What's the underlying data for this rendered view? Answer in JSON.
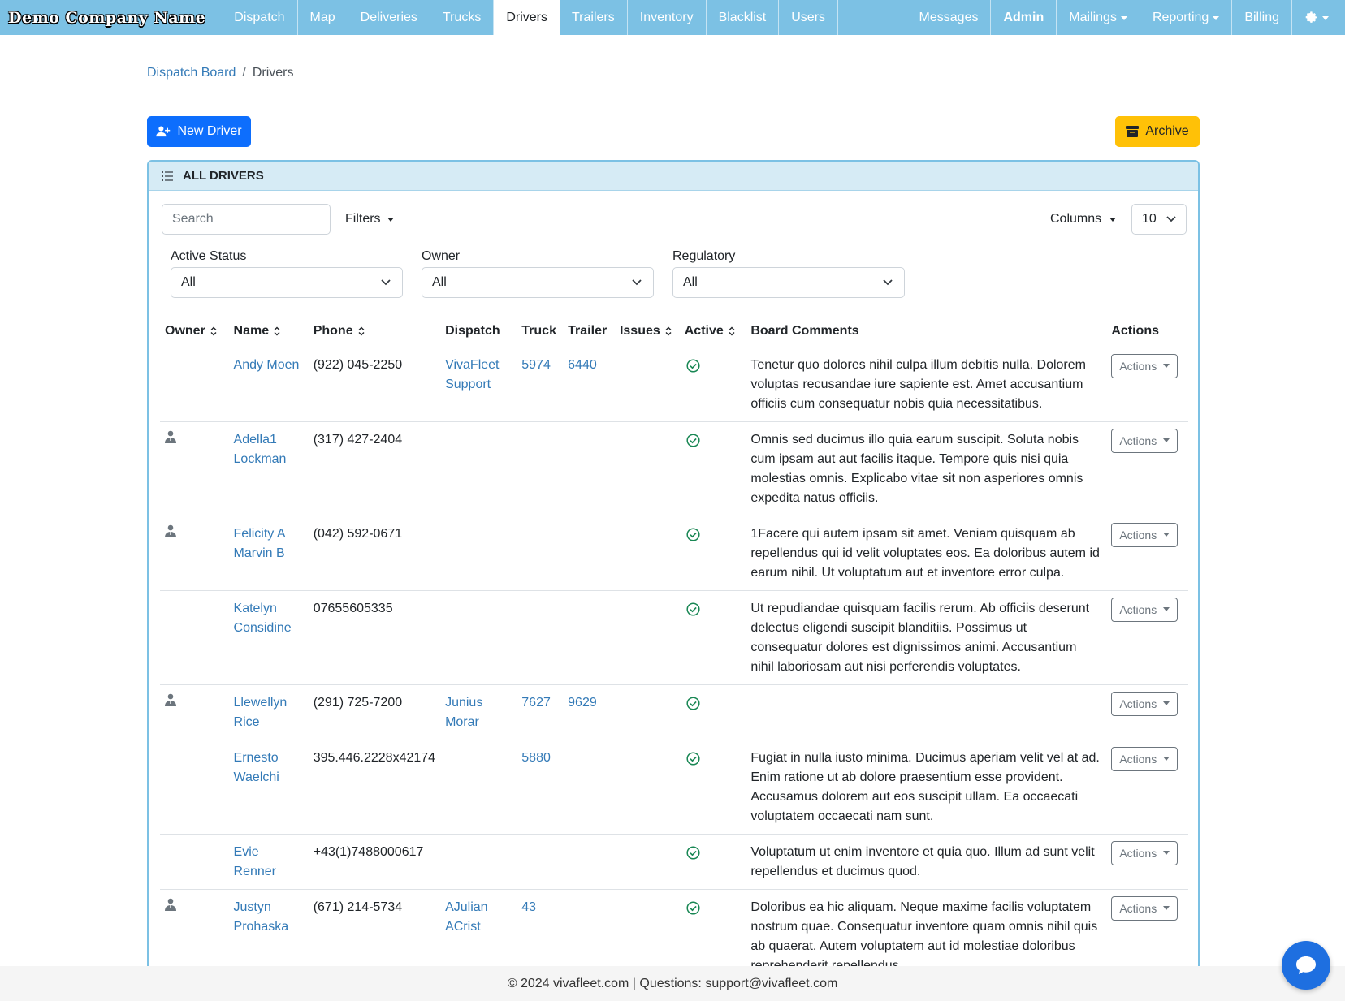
{
  "nav": {
    "brand": "Demo Company Name",
    "items": [
      {
        "label": "Dispatch",
        "name": "nav-dispatch"
      },
      {
        "label": "Map",
        "name": "nav-map"
      },
      {
        "label": "Deliveries",
        "name": "nav-deliveries"
      },
      {
        "label": "Trucks",
        "name": "nav-trucks"
      },
      {
        "label": "Drivers",
        "name": "nav-drivers"
      },
      {
        "label": "Trailers",
        "name": "nav-trailers"
      },
      {
        "label": "Inventory",
        "name": "nav-inventory"
      },
      {
        "label": "Blacklist",
        "name": "nav-blacklist"
      },
      {
        "label": "Users",
        "name": "nav-users"
      }
    ],
    "right": {
      "messages": "Messages",
      "admin": "Admin",
      "mailings": "Mailings",
      "reporting": "Reporting",
      "billing": "Billing"
    },
    "settings_icon": "gear-icon"
  },
  "breadcrumb": {
    "parent": "Dispatch Board",
    "separator": "/",
    "current": "Drivers"
  },
  "buttons": {
    "new_driver": "New Driver",
    "archive": "Archive"
  },
  "card": {
    "title": "ALL DRIVERS"
  },
  "toolbar": {
    "search_placeholder": "Search",
    "filters": "Filters",
    "columns": "Columns",
    "per_page": "10"
  },
  "filters": {
    "active_status": {
      "label": "Active Status",
      "value": "All"
    },
    "owner": {
      "label": "Owner",
      "value": "All"
    },
    "regulatory": {
      "label": "Regulatory",
      "value": "All"
    }
  },
  "table": {
    "headers": {
      "owner": "Owner",
      "name": "Name",
      "phone": "Phone",
      "dispatch": "Dispatch",
      "truck": "Truck",
      "trailer": "Trailer",
      "issues": "Issues",
      "active": "Active",
      "comments": "Board Comments",
      "actions": "Actions"
    },
    "action_label": "Actions",
    "rows": [
      {
        "owner": false,
        "name": "Andy Moen",
        "phone": "(922) 045-2250",
        "dispatch": "VivaFleet Support",
        "truck": "5974",
        "trailer": "6440",
        "active": true,
        "comment": "Tenetur quo dolores nihil culpa illum debitis nulla. Dolorem voluptas recusandae iure sapiente est. Amet accusantium officiis cum consequatur nobis quia necessitatibus."
      },
      {
        "owner": true,
        "name": "Adella1 Lockman",
        "phone": "(317) 427-2404",
        "dispatch": "",
        "truck": "",
        "trailer": "",
        "active": true,
        "comment": "Omnis sed ducimus illo quia earum suscipit. Soluta nobis cum ipsam aut aut facilis itaque. Tempore quis nisi quia molestias omnis. Explicabo vitae sit non asperiores omnis expedita natus officiis."
      },
      {
        "owner": true,
        "name": "Felicity A Marvin B",
        "phone": "(042) 592-0671",
        "dispatch": "",
        "truck": "",
        "trailer": "",
        "active": true,
        "comment": "1Facere qui autem ipsam sit amet. Veniam quisquam ab repellendus qui id velit voluptates eos. Ea doloribus autem id earum nihil. Ut voluptatum aut et inventore error culpa."
      },
      {
        "owner": false,
        "name": "Katelyn Considine",
        "phone": "07655605335",
        "dispatch": "",
        "truck": "",
        "trailer": "",
        "active": true,
        "comment": "Ut repudiandae quisquam facilis rerum. Ab officiis deserunt delectus eligendi suscipit blanditiis. Possimus ut consequatur dolores est dignissimos animi. Accusantium nihil laboriosam aut nisi perferendis voluptates."
      },
      {
        "owner": true,
        "name": "Llewellyn Rice",
        "phone": "(291) 725-7200",
        "dispatch": "Junius Morar",
        "truck": "7627",
        "trailer": "9629",
        "active": true,
        "comment": ""
      },
      {
        "owner": false,
        "name": "Ernesto Waelchi",
        "phone": "395.446.2228x42174",
        "dispatch": "",
        "truck": "5880",
        "trailer": "",
        "active": true,
        "comment": "Fugiat in nulla iusto minima. Ducimus aperiam velit vel at ad. Enim ratione ut ab dolore praesentium esse provident. Accusamus dolorem aut eos suscipit ullam. Ea occaecati voluptatem occaecati nam sunt."
      },
      {
        "owner": false,
        "name": "Evie Renner",
        "phone": "+43(1)7488000617",
        "dispatch": "",
        "truck": "",
        "trailer": "",
        "active": true,
        "comment": "Voluptatum ut enim inventore et quia quo. Illum ad sunt velit repellendus et ducimus quod."
      },
      {
        "owner": true,
        "name": "Justyn Prohaska",
        "phone": "(671) 214-5734",
        "dispatch": "AJulian ACrist",
        "truck": "43",
        "trailer": "",
        "active": true,
        "comment": "Doloribus ea hic aliquam. Neque maxime facilis voluptatem nostrum quae. Consequatur inventore quam omnis nihil quis ab quaerat. Autem voluptatem aut id molestiae doloribus reprehenderit repellendus."
      }
    ]
  },
  "footer": {
    "text": "© 2024 vivafleet.com | Questions: support@vivafleet.com"
  },
  "colors": {
    "navbar": "#7cc1e4",
    "primary": "#0d6efd",
    "warning": "#ffc107",
    "link": "#337ab7",
    "success": "#198754"
  }
}
